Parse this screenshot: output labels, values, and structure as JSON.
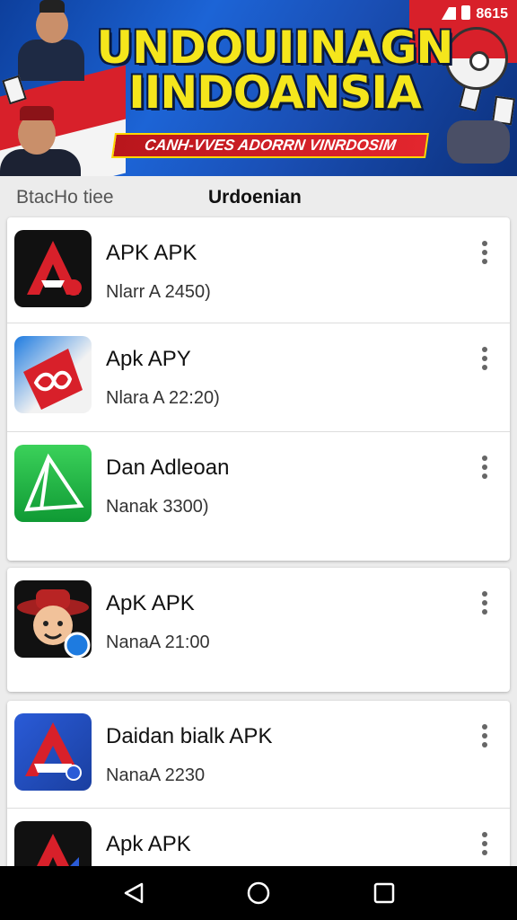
{
  "status_bar": {
    "time": "8615"
  },
  "banner": {
    "title_line1": "UNDOUIINAGN",
    "title_line2": "IINDOANSIA",
    "ribbon": "CANH-VVES ADORRN VINRDOSIM"
  },
  "tabs": [
    {
      "label": "BtacHo tiee"
    },
    {
      "label": "Urdoenian"
    }
  ],
  "apps": [
    {
      "name": "APK APK",
      "meta": "Nlarr A 2450)",
      "icon": "red-a-logo-icon"
    },
    {
      "name": "Apk APY",
      "meta": "Nlara A 22:20)",
      "icon": "red-infinity-logo-icon"
    },
    {
      "name": "Dan Adleoan",
      "meta": "Nanak 3300)",
      "icon": "green-triangle-logo-icon"
    },
    {
      "name": "ApK APK",
      "meta": "NanaA 21:00",
      "icon": "cowboy-avatar-icon"
    },
    {
      "name": "Daidan bialk APK",
      "meta": "NanaA 2230",
      "icon": "blue-a-logo-icon"
    },
    {
      "name": "Apk APK",
      "meta": "",
      "icon": "black-a-logo-icon"
    }
  ],
  "colors": {
    "banner_blue": "#1c64d6",
    "title_yellow": "#f5e61c",
    "flag_red": "#d8202a"
  }
}
